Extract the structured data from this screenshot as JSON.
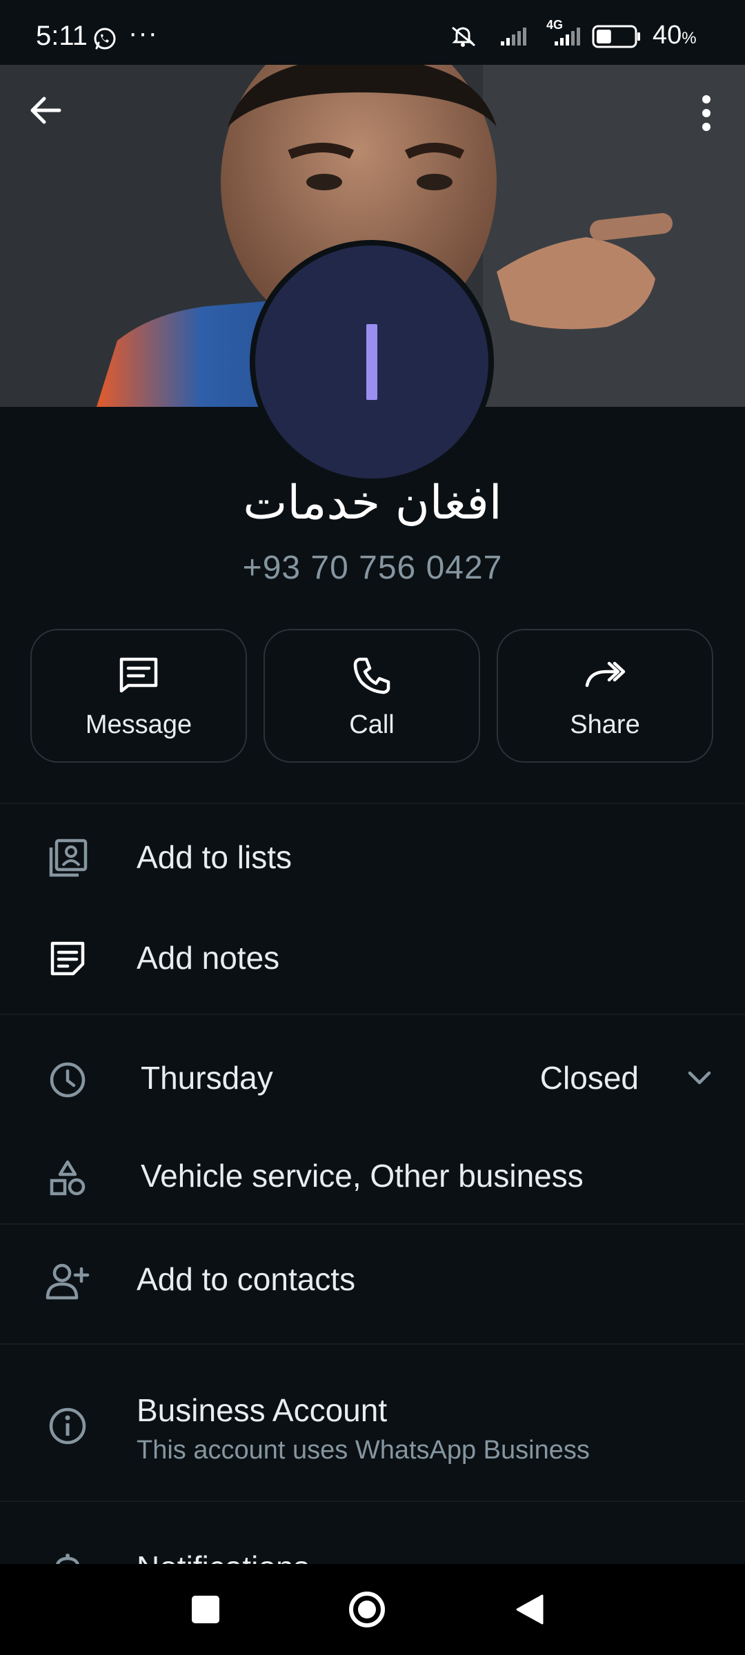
{
  "status_bar": {
    "time": "5:11",
    "dots": "···",
    "network": "4G",
    "battery_percent": "40",
    "battery_unit": "%",
    "battery_level": 0.4
  },
  "profile": {
    "avatar_initial": "I",
    "name": "افغان خدمات",
    "phone": "+93 70 756 0427"
  },
  "actions": {
    "message_label": "Message",
    "call_label": "Call",
    "share_label": "Share"
  },
  "rows": {
    "add_to_lists": "Add to lists",
    "add_notes": "Add notes",
    "hours_day": "Thursday",
    "hours_status": "Closed",
    "category": "Vehicle service, Other business",
    "add_to_contacts": "Add to contacts",
    "business_title": "Business Account",
    "business_sub": "This account uses WhatsApp Business",
    "notifications": "Notifications"
  },
  "icons": {
    "back": "arrow-left-icon",
    "more": "more-vert-icon",
    "message": "message-icon",
    "call": "phone-icon",
    "share": "share-forward-icon",
    "lists": "lists-icon",
    "notes": "notes-icon",
    "clock": "clock-icon",
    "category": "shapes-icon",
    "add_contact": "person-add-icon",
    "info": "info-icon",
    "bell": "bell-icon"
  },
  "colors": {
    "background": "#0b1014",
    "avatar_bg": "#22284a",
    "avatar_accent": "#9b8ef1",
    "secondary_text": "#8696a0"
  }
}
